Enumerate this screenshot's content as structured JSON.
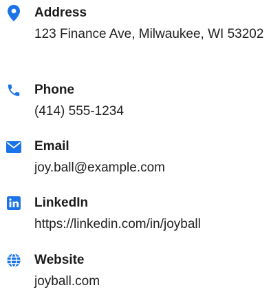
{
  "accent_color": "#1a73e8",
  "contact": {
    "address": {
      "icon": "map-pin-icon",
      "label": "Address",
      "value": "123 Finance Ave, Milwaukee, WI 53202"
    },
    "phone": {
      "icon": "phone-icon",
      "label": "Phone",
      "value": "(414) 555-1234"
    },
    "email": {
      "icon": "envelope-icon",
      "label": "Email",
      "value": "joy.ball@example.com"
    },
    "linkedin": {
      "icon": "linkedin-icon",
      "label": "LinkedIn",
      "value": "https://linkedin.com/in/joyball"
    },
    "website": {
      "icon": "globe-icon",
      "label": "Website",
      "value": "joyball.com"
    }
  }
}
